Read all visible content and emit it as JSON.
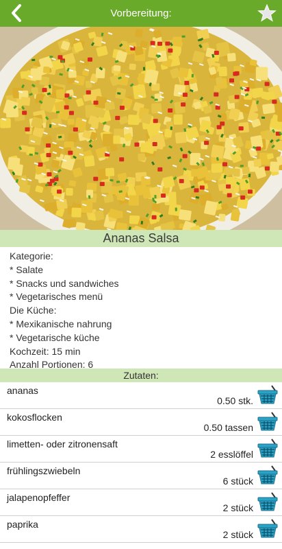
{
  "header": {
    "title": "Vorbereitung:"
  },
  "photo": {
    "alt": "Ananas Salsa"
  },
  "dish": {
    "title": "Ananas Salsa"
  },
  "info": {
    "category_label": "Kategorie:",
    "categories": [
      "* Salate",
      "* Snacks und sandwiches",
      "* Vegetarisches menü"
    ],
    "cuisine_label": "Die Küche:",
    "cuisines": [
      "* Mexikanische nahrung",
      "* Vegetarische küche"
    ],
    "cook_time": "Kochzeit: 15 min",
    "portions": "Anzahl Portionen: 6"
  },
  "ingredients_header": "Zutaten:",
  "ingredients": [
    {
      "name": "ananas",
      "amount": "0.50 stk."
    },
    {
      "name": "kokosflocken",
      "amount": "0.50 tassen"
    },
    {
      "name": "limetten- oder zitronensaft",
      "amount": "2 esslöffel"
    },
    {
      "name": "frühlingszwiebeln",
      "amount": "6 stück"
    },
    {
      "name": "jalapenopfeffer",
      "amount": "2 stück"
    },
    {
      "name": "paprika",
      "amount": "2 stück"
    }
  ],
  "colors": {
    "accent": "#6aaa2b",
    "band": "#cfe6b7",
    "basket": "#29a3c7"
  }
}
